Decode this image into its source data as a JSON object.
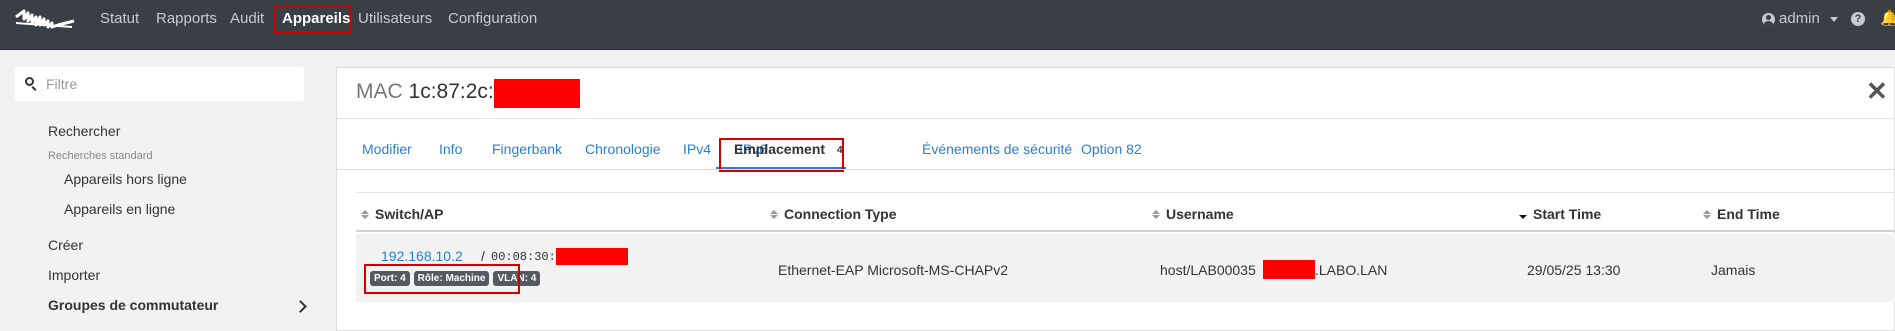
{
  "nav": {
    "items": [
      "Statut",
      "Rapports",
      "Audit",
      "Appareils",
      "Utilisateurs",
      "Configuration"
    ],
    "active": "Appareils",
    "user": "admin",
    "help": "?"
  },
  "sidebar": {
    "filter_placeholder": "Filtre",
    "search": "Rechercher",
    "standard_searches": "Recherches standard",
    "offline": "Appareils hors ligne",
    "online": "Appareils en ligne",
    "create": "Créer",
    "import": "Importer",
    "switch_groups": "Groupes de commutateur"
  },
  "panel": {
    "mac_label": "MAC",
    "mac_value": "1c:87:2c:",
    "close": "✕",
    "tabs": [
      "Modifier",
      "Info",
      "Fingerbank",
      "Chronologie",
      "IPv4",
      "IPv6",
      "Emplacement",
      "Événements de sécurité",
      "Option 82"
    ],
    "active_tab_badge": "4"
  },
  "table": {
    "headers": [
      "Switch/AP",
      "Connection Type",
      "Username",
      "Start Time",
      "End Time"
    ],
    "sorted_column": "Start Time",
    "rows": [
      {
        "switch_ip": "192.168.10.2",
        "separator": "/",
        "switch_mac": "00:08:30:",
        "badges": [
          "Port: 4",
          "Rôle: Machine",
          "VLAN: 4"
        ],
        "connection_type": "Ethernet-EAP Microsoft-MS-CHAPv2",
        "username_prefix": "host/LAB00035",
        "username_suffix": ".LABO.LAN",
        "start_time": "29/05/25 13:30",
        "end_time": "Jamais"
      }
    ]
  },
  "colors": {
    "navbar": "#3a3f46",
    "link": "#2a7fd4",
    "highlight": "#d40000",
    "redaction": "#ff0000"
  }
}
